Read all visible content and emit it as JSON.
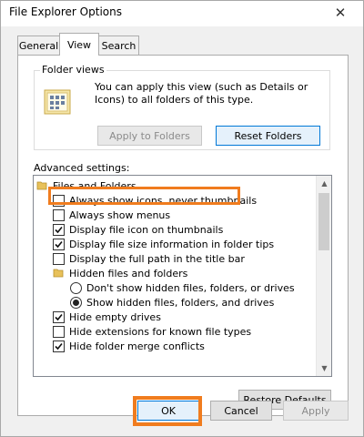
{
  "window": {
    "title": "File Explorer Options",
    "close_glyph": "✕"
  },
  "tabs": [
    {
      "label": "General",
      "active": false
    },
    {
      "label": "View",
      "active": true
    },
    {
      "label": "Search",
      "active": false
    }
  ],
  "folder_views": {
    "group_label": "Folder views",
    "description": "You can apply this view (such as Details or Icons) to all folders of this type.",
    "apply_button": "Apply to Folders",
    "reset_button": "Reset Folders"
  },
  "advanced": {
    "label": "Advanced settings:",
    "items": [
      {
        "type": "folder",
        "label": "Files and Folders"
      },
      {
        "type": "checkbox",
        "label": "Always show icons, never thumbnails",
        "checked": false,
        "highlighted": true
      },
      {
        "type": "checkbox",
        "label": "Always show menus",
        "checked": false
      },
      {
        "type": "checkbox",
        "label": "Display file icon on thumbnails",
        "checked": true
      },
      {
        "type": "checkbox",
        "label": "Display file size information in folder tips",
        "checked": true
      },
      {
        "type": "checkbox",
        "label": "Display the full path in the title bar",
        "checked": false
      },
      {
        "type": "folder",
        "label": "Hidden files and folders"
      },
      {
        "type": "radio",
        "label": "Don't show hidden files, folders, or drives",
        "checked": false
      },
      {
        "type": "radio",
        "label": "Show hidden files, folders, and drives",
        "checked": true
      },
      {
        "type": "checkbox",
        "label": "Hide empty drives",
        "checked": true
      },
      {
        "type": "checkbox",
        "label": "Hide extensions for known file types",
        "checked": false
      },
      {
        "type": "checkbox",
        "label": "Hide folder merge conflicts",
        "checked": true
      }
    ]
  },
  "restore_button": "Restore Defaults",
  "footer": {
    "ok": "OK",
    "cancel": "Cancel",
    "apply": "Apply"
  },
  "colors": {
    "highlight": "#f07c1e",
    "focus": "#0078d7"
  }
}
